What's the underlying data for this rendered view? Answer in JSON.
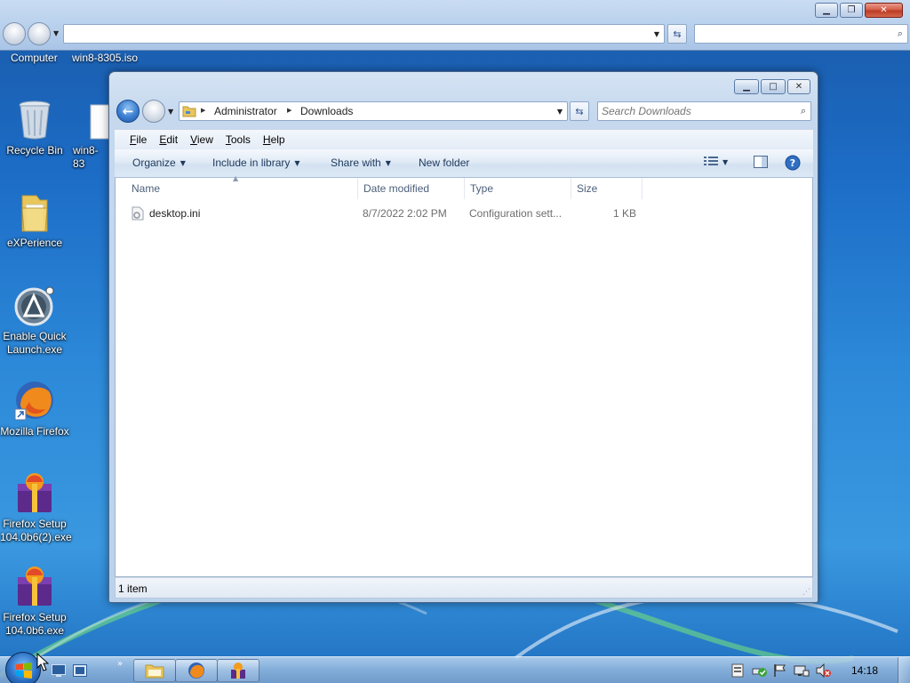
{
  "background_window": {
    "breadcrumb": [
      "Computer",
      "win8-8305.iso"
    ]
  },
  "window": {
    "address_path": [
      "Administrator",
      "Downloads"
    ],
    "search_placeholder": "Search Downloads",
    "menu": [
      "File",
      "Edit",
      "View",
      "Tools",
      "Help"
    ],
    "commands": {
      "organize": "Organize",
      "include_in_library": "Include in library",
      "share_with": "Share with",
      "new_folder": "New folder"
    },
    "columns": [
      "Name",
      "Date modified",
      "Type",
      "Size"
    ],
    "files": [
      {
        "name": "desktop.ini",
        "date_modified": "8/7/2022 2:02 PM",
        "type": "Configuration sett...",
        "size": "1 KB"
      }
    ],
    "status": "1 item"
  },
  "desktop_icons": [
    {
      "label": "Recycle Bin",
      "icon": "recycle-bin-icon"
    },
    {
      "label": "win8-83",
      "icon": "file-icon"
    },
    {
      "label": "eXPerience",
      "icon": "folder-icon"
    },
    {
      "label": "Enable Quick Launch.exe",
      "icon": "quick-launch-icon"
    },
    {
      "label": "Mozilla Firefox",
      "icon": "firefox-icon"
    },
    {
      "label": "Firefox Setup 104.0b6(2).exe",
      "icon": "installer-icon"
    },
    {
      "label": "Firefox Setup 104.0b6.exe",
      "icon": "installer-icon"
    }
  ],
  "taskbar": {
    "clock": "14:18",
    "pinned": [
      "explorer-icon",
      "firefox-icon",
      "installer-icon"
    ],
    "tray": [
      "action-center-icon",
      "network-icon",
      "flag-icon",
      "display-icon",
      "volume-muted-icon"
    ]
  },
  "colors": {
    "desktop_blue": "#1c6cc6",
    "window_chrome": "#c5d8ee",
    "accent_nav": "#3b7ed0"
  }
}
